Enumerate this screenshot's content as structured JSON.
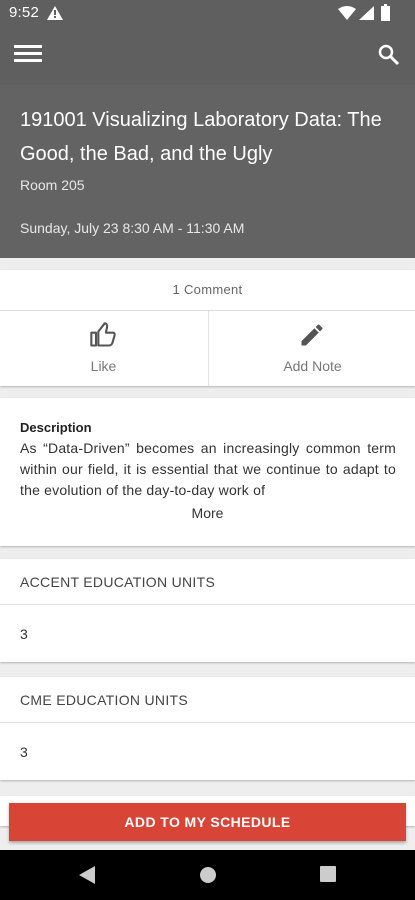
{
  "status_bar": {
    "time": "9:52",
    "icons": [
      "warning-icon",
      "wifi-icon",
      "signal-icon",
      "battery-icon"
    ]
  },
  "app_bar": {
    "menu_icon": "hamburger-menu-icon",
    "search_icon": "search-icon"
  },
  "session": {
    "title": "191001 Visualizing Laboratory Data: The Good, the Bad, and the Ugly",
    "room": "Room 205",
    "datetime": "Sunday, July 23 8:30 AM - 11:30 AM"
  },
  "comments": {
    "label": "1 Comment"
  },
  "actions": {
    "like_label": "Like",
    "add_note_label": "Add Note"
  },
  "description": {
    "heading": "Description",
    "text": "As “Data-Driven” becomes an increasingly common term within our field, it is essential that we continue to adapt to the evolution of the day-to-day work of",
    "more_label": "More"
  },
  "accent_units": {
    "heading": "ACCENT EDUCATION UNITS",
    "value": "3"
  },
  "cme_units": {
    "heading": "CME EDUCATION UNITS",
    "value": "3"
  },
  "schedule_button": {
    "label": "ADD TO MY SCHEDULE"
  },
  "colors": {
    "header": "#636363",
    "app_bar": "#5f5f5f",
    "accent_button": "#d84436"
  }
}
